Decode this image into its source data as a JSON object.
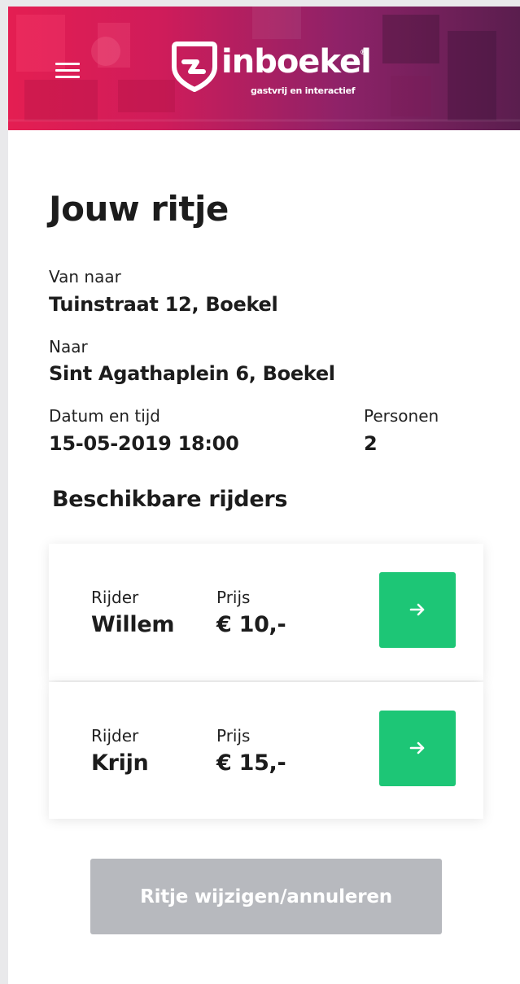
{
  "header": {
    "menu_icon": "hamburger-menu-icon",
    "logo_icon": "inboekel-logo-icon",
    "logo_text": "inboekel",
    "logo_registered": "®",
    "logo_tagline": "gastvrij en interactief",
    "colors": {
      "primary": "#e41e52",
      "secondary": "#5a1e4e"
    }
  },
  "ride": {
    "title": "Jouw ritje",
    "from_label": "Van naar",
    "from_value": "Tuinstraat 12, Boekel",
    "to_label": "Naar",
    "to_value": "Sint Agathaplein 6, Boekel",
    "datetime_label": "Datum en tijd",
    "datetime_value": "15-05-2019 18:00",
    "persons_label": "Personen",
    "persons_value": "2"
  },
  "drivers": {
    "title": "Beschikbare rijders",
    "driver_label": "Rijder",
    "price_label": "Prijs",
    "arrow_icon": "arrow-right-icon",
    "button_color": "#1dc676",
    "items": [
      {
        "name": "Willem",
        "price": "€ 10,-"
      },
      {
        "name": "Krijn",
        "price": "€ 15,-"
      }
    ]
  },
  "footer": {
    "change_button_label": "Ritje wijzigen/annuleren",
    "button_color": "#b7b9be"
  }
}
